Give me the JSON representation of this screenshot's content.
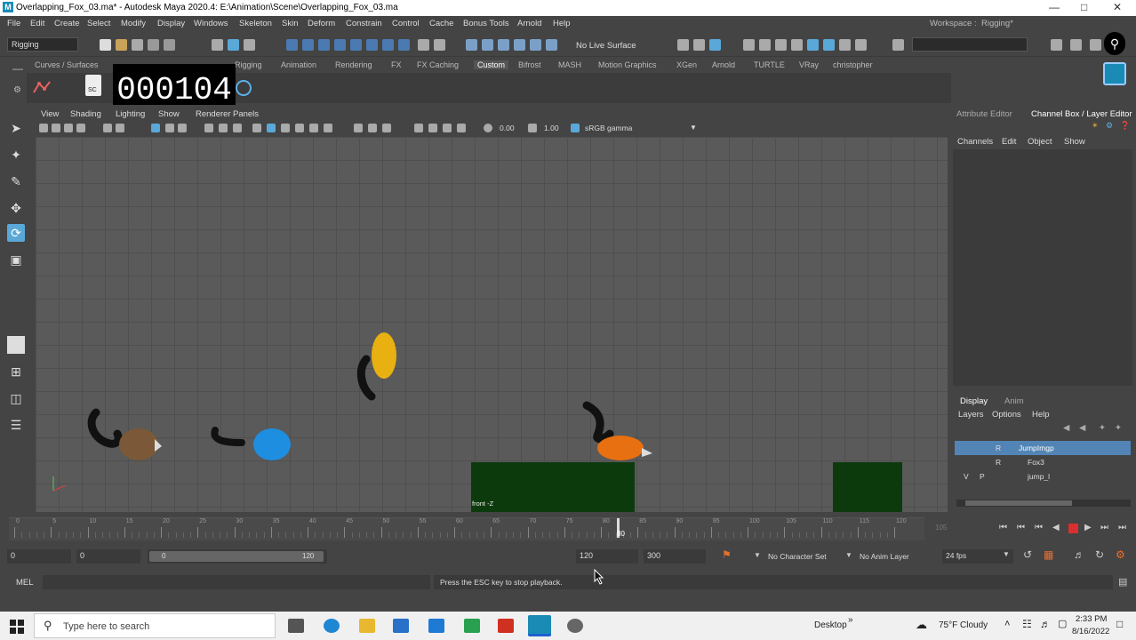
{
  "titlebar": {
    "title": "Overlapping_Fox_03.ma* - Autodesk Maya 2020.4: E:\\Animation\\Scene\\Overlapping_Fox_03.ma",
    "app_icon": "M"
  },
  "menu": [
    "File",
    "Edit",
    "Create",
    "Select",
    "Modify",
    "Display",
    "Windows",
    "Skeleton",
    "Skin",
    "Deform",
    "Constrain",
    "Control",
    "Cache",
    "Bonus Tools",
    "Arnold",
    "Help"
  ],
  "workspace": {
    "label": "Workspace :",
    "value": "Rigging*"
  },
  "status": {
    "mode": "Rigging",
    "live_surface": "No Live Surface"
  },
  "shelf_tabs": [
    "Curves / Surfaces",
    "Rigging",
    "Animation",
    "Rendering",
    "FX",
    "FX Caching",
    "Custom",
    "Bifrost",
    "MASH",
    "Motion Graphics",
    "XGen",
    "Arnold",
    "TURTLE",
    "VRay",
    "christopher"
  ],
  "shelf_active": "Custom",
  "shelf_sc_label": "SC",
  "counter": "000104",
  "panel_menu": [
    "View",
    "Shading",
    "Lighting",
    "Show",
    "Renderer",
    "Panels"
  ],
  "panel_tools": {
    "exposure": "0.00",
    "gamma": "1.00",
    "colorspace": "sRGB gamma"
  },
  "viewport": {
    "camera_label": "front -Z"
  },
  "right_tabs": {
    "attr": "Attribute Editor",
    "channel": "Channel Box / Layer Editor"
  },
  "channel_menu": [
    "Channels",
    "Edit",
    "Object",
    "Show"
  ],
  "layer_tabs": [
    "Display",
    "Anim"
  ],
  "layer_menu": [
    "Layers",
    "Options",
    "Help"
  ],
  "layers": [
    {
      "v": "",
      "p": "",
      "r": "R",
      "name": "JumpImgp",
      "selected": true
    },
    {
      "v": "",
      "p": "",
      "r": "R",
      "name": "Fox3",
      "selected": false
    },
    {
      "v": "V",
      "p": "P",
      "r": "",
      "name": "jump_l",
      "selected": false
    }
  ],
  "timeline": {
    "ticks": [
      "0",
      "5",
      "10",
      "15",
      "20",
      "25",
      "30",
      "35",
      "40",
      "45",
      "50",
      "55",
      "60",
      "65",
      "70",
      "75",
      "80",
      "85",
      "90",
      "95",
      "100",
      "105",
      "110",
      "115",
      "120"
    ],
    "current": "80",
    "end_marker": "105"
  },
  "range": {
    "start": "0",
    "start2": "0",
    "slider_start": "0",
    "slider_end": "120",
    "end": "120",
    "end2": "300",
    "char_set": "No Character Set",
    "anim_layer": "No Anim Layer",
    "fps": "24 fps"
  },
  "mel": {
    "label": "MEL",
    "message": "Press the ESC key to stop playback."
  },
  "taskbar": {
    "search_placeholder": "Type here to search",
    "desktop": "Desktop",
    "weather": "75°F  Cloudy",
    "time": "2:33 PM",
    "date": "8/16/2022"
  }
}
